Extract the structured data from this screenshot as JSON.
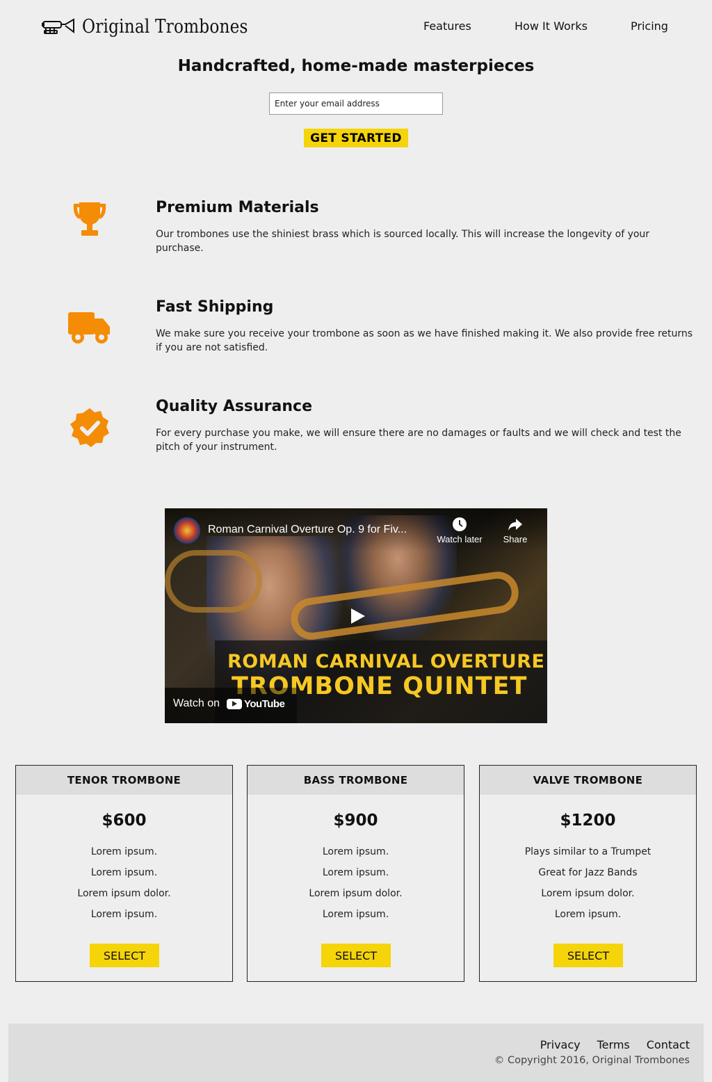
{
  "header": {
    "brand": "Original Trombones",
    "nav": [
      {
        "label": "Features"
      },
      {
        "label": "How It Works"
      },
      {
        "label": "Pricing"
      }
    ]
  },
  "hero": {
    "title": "Handcrafted, home-made masterpieces",
    "email_placeholder": "Enter your email address",
    "cta_label": "GET STARTED"
  },
  "features": [
    {
      "icon": "trophy-icon",
      "title": "Premium Materials",
      "text": "Our trombones use the shiniest brass which is sourced locally. This will increase the longevity of your purchase."
    },
    {
      "icon": "truck-icon",
      "title": "Fast Shipping",
      "text": "We make sure you receive your trombone as soon as we have finished making it. We also provide free returns if you are not satisfied."
    },
    {
      "icon": "verified-badge-icon",
      "title": "Quality Assurance",
      "text": "For every purchase you make, we will ensure there are no damages or faults and we will check and test the pitch of your instrument."
    }
  ],
  "video": {
    "title": "Roman Carnival Overture Op. 9 for Fiv...",
    "watch_later": "Watch later",
    "share": "Share",
    "caption_line1": "ROMAN CARNIVAL OVERTURE",
    "caption_line2": "TROMBONE QUINTET",
    "watch_on": "Watch on",
    "youtube": "YouTube"
  },
  "pricing": [
    {
      "name": "TENOR TROMBONE",
      "price": "$600",
      "features": [
        "Lorem ipsum.",
        "Lorem ipsum.",
        "Lorem ipsum dolor.",
        "Lorem ipsum."
      ],
      "button": "SELECT"
    },
    {
      "name": "BASS TROMBONE",
      "price": "$900",
      "features": [
        "Lorem ipsum.",
        "Lorem ipsum.",
        "Lorem ipsum dolor.",
        "Lorem ipsum."
      ],
      "button": "SELECT"
    },
    {
      "name": "VALVE TROMBONE",
      "price": "$1200",
      "features": [
        "Plays similar to a Trumpet",
        "Great for Jazz Bands",
        "Lorem ipsum dolor.",
        "Lorem ipsum."
      ],
      "button": "SELECT"
    }
  ],
  "footer": {
    "links": [
      {
        "label": "Privacy"
      },
      {
        "label": "Terms"
      },
      {
        "label": "Contact"
      }
    ],
    "copyright": "© Copyright 2016, Original Trombones"
  },
  "colors": {
    "accent_yellow": "#f5d40a",
    "icon_orange": "#f48c06",
    "background": "#eeeeee",
    "panel_gray": "#dddddd"
  }
}
